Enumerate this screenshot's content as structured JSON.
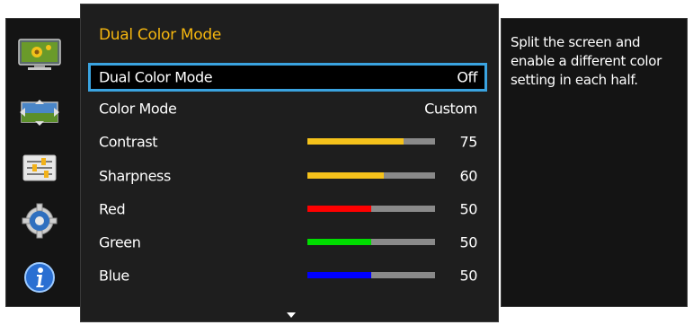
{
  "sidebar": {
    "icons": [
      "picture-icon",
      "screen-size-icon",
      "settings-sliders-icon",
      "gear-icon",
      "info-icon"
    ]
  },
  "menu": {
    "title": "Dual Color Mode",
    "rows": [
      {
        "label": "Dual Color Mode",
        "value": "Off",
        "selected": true
      },
      {
        "label": "Color Mode",
        "value": "Custom"
      },
      {
        "label": "Contrast",
        "value": "75",
        "level": 0.75,
        "color": "#f5c21b"
      },
      {
        "label": "Sharpness",
        "value": "60",
        "level": 0.6,
        "color": "#f5c21b"
      },
      {
        "label": "Red",
        "value": "50",
        "level": 0.5,
        "color": "#ff0000"
      },
      {
        "label": "Green",
        "value": "50",
        "level": 0.5,
        "color": "#00dd00"
      },
      {
        "label": "Blue",
        "value": "50",
        "level": 0.5,
        "color": "#0000ff"
      }
    ],
    "scroll_icon": "down-arrow-icon"
  },
  "help": {
    "text": "Split the screen and enable a different color setting in each half."
  },
  "colors": {
    "accent_title": "#f5b60f",
    "selection_border": "#3aa3e0",
    "panel_bg": "#1e1e1e",
    "bar_track": "#8a8a8a"
  }
}
